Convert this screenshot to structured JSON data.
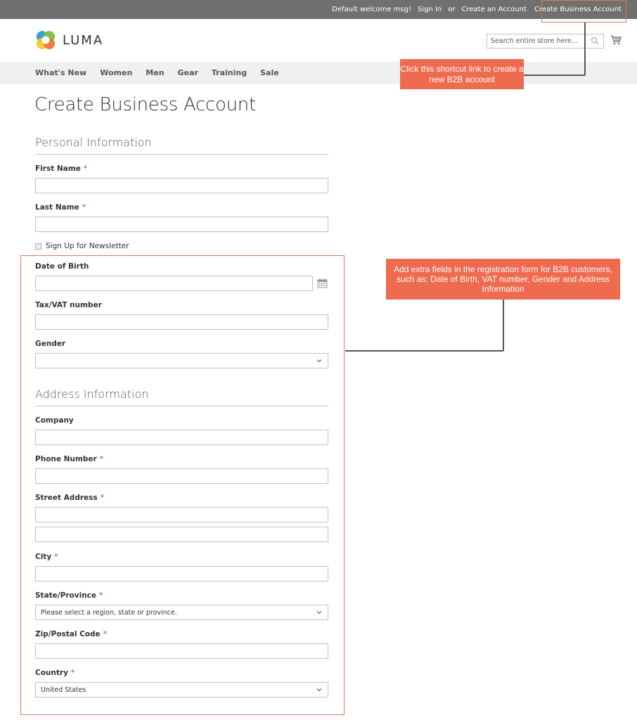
{
  "topbar": {
    "welcome": "Default welcome msg!",
    "sign_in": "Sign In",
    "or": "or",
    "create_account": "Create an Account",
    "create_business_account": "Create Business Account"
  },
  "header": {
    "logo_text": "LUMA",
    "search_placeholder": "Search entire store here...",
    "search_icon": "search-icon",
    "cart_icon": "cart-icon"
  },
  "nav": {
    "items": [
      "What's New",
      "Women",
      "Men",
      "Gear",
      "Training",
      "Sale"
    ]
  },
  "page": {
    "title": "Create Business Account"
  },
  "personal": {
    "legend": "Personal Information",
    "first_name": {
      "label": "First Name",
      "required": "*",
      "value": ""
    },
    "last_name": {
      "label": "Last Name",
      "required": "*",
      "value": ""
    },
    "newsletter": {
      "label": "Sign Up for Newsletter",
      "checked": false
    },
    "dob": {
      "label": "Date of Birth",
      "value": "",
      "icon": "calendar-icon"
    },
    "taxvat": {
      "label": "Tax/VAT number",
      "value": ""
    },
    "gender": {
      "label": "Gender",
      "selected": ""
    }
  },
  "address": {
    "legend": "Address Information",
    "company": {
      "label": "Company",
      "value": ""
    },
    "phone": {
      "label": "Phone Number",
      "required": "*",
      "value": ""
    },
    "street": {
      "label": "Street Address",
      "required": "*",
      "line1": "",
      "line2": ""
    },
    "city": {
      "label": "City",
      "required": "*",
      "value": ""
    },
    "region": {
      "label": "State/Province",
      "required": "*",
      "selected": "Please select a region, state or province."
    },
    "zip": {
      "label": "Zip/Postal Code",
      "required": "*",
      "value": ""
    },
    "country": {
      "label": "Country",
      "required": "*",
      "selected": "United States"
    }
  },
  "annotations": {
    "callout_shortcut": "Click this shortcut link to create a new B2B account",
    "callout_fields": "Add extra fields in the registration form for B2B customers, such as: Date of Birth, VAT number, Gender and Address Information",
    "accent_color": "#ef6b4f",
    "frame_color": "#e0765e"
  }
}
